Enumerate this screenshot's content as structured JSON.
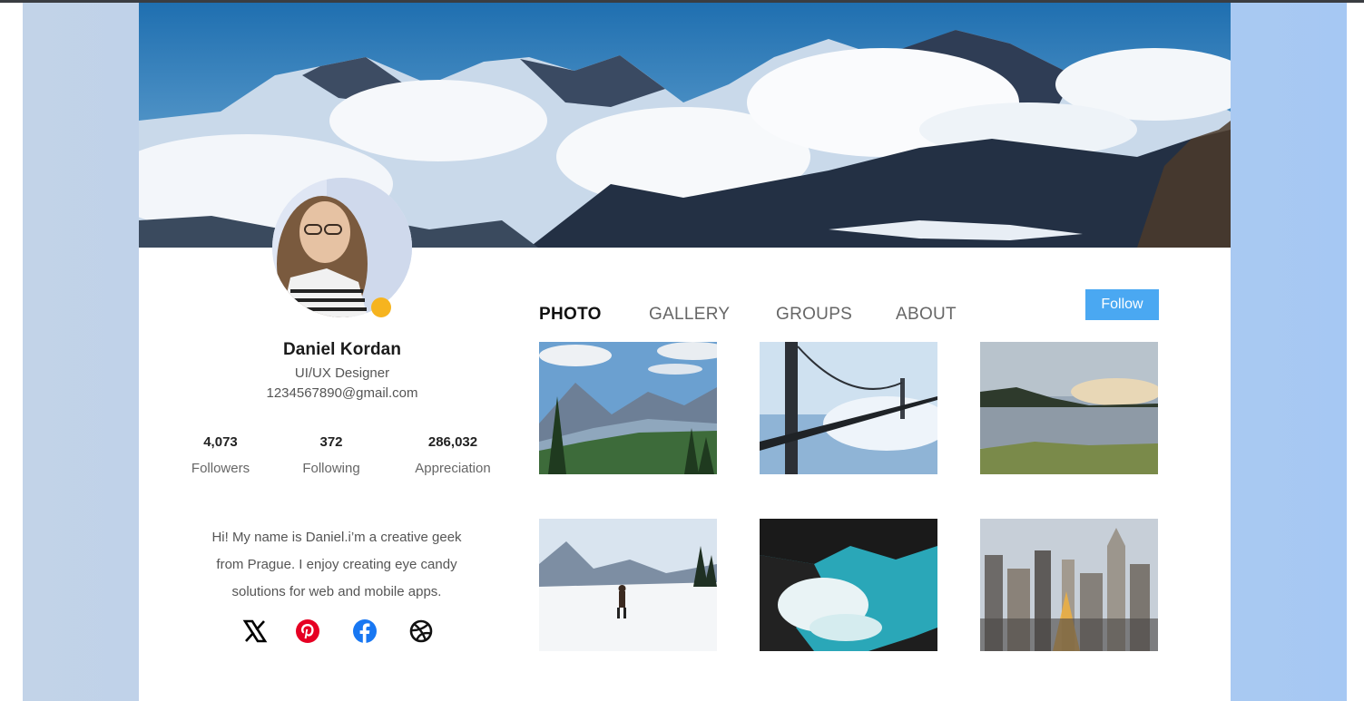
{
  "profile": {
    "name": "Daniel Kordan",
    "role": "UI/UX Designer",
    "email": "1234567890@gmail.com",
    "avatar_icon": "avatar-photo",
    "status_color": "#f6b41f"
  },
  "stats": [
    {
      "value": "4,073",
      "label": "Followers"
    },
    {
      "value": "372",
      "label": "Following"
    },
    {
      "value": "286,032",
      "label": "Appreciation"
    }
  ],
  "bio": {
    "line1": "Hi! My name is Daniel.i’m a creative geek",
    "line2": "from Prague. I enjoy creating eye candy",
    "line3": "solutions for web and mobile apps."
  },
  "socials": [
    {
      "icon": "x-icon",
      "color": "#000000"
    },
    {
      "icon": "pinterest-icon",
      "color": "#e60023"
    },
    {
      "icon": "facebook-icon",
      "color": "#1877f2"
    },
    {
      "icon": "dribbble-icon",
      "color": "#111111"
    }
  ],
  "tabs": [
    {
      "label": "PHOTO",
      "active": true
    },
    {
      "label": "GALLERY",
      "active": false
    },
    {
      "label": "GROUPS",
      "active": false
    },
    {
      "label": "ABOUT",
      "active": false
    }
  ],
  "follow_button": {
    "label": "Follow",
    "color": "#4aa8f2"
  },
  "photos": [
    {
      "subject": "mountain-valley-photo"
    },
    {
      "subject": "golden-gate-bridge-fog-photo"
    },
    {
      "subject": "lake-sunset-photo"
    },
    {
      "subject": "snowy-hiker-photo"
    },
    {
      "subject": "ocean-rocks-waves-photo"
    },
    {
      "subject": "city-skyline-photo"
    }
  ],
  "colors": {
    "accent": "#4aa8f2",
    "background_panel": "#b6cfee"
  }
}
